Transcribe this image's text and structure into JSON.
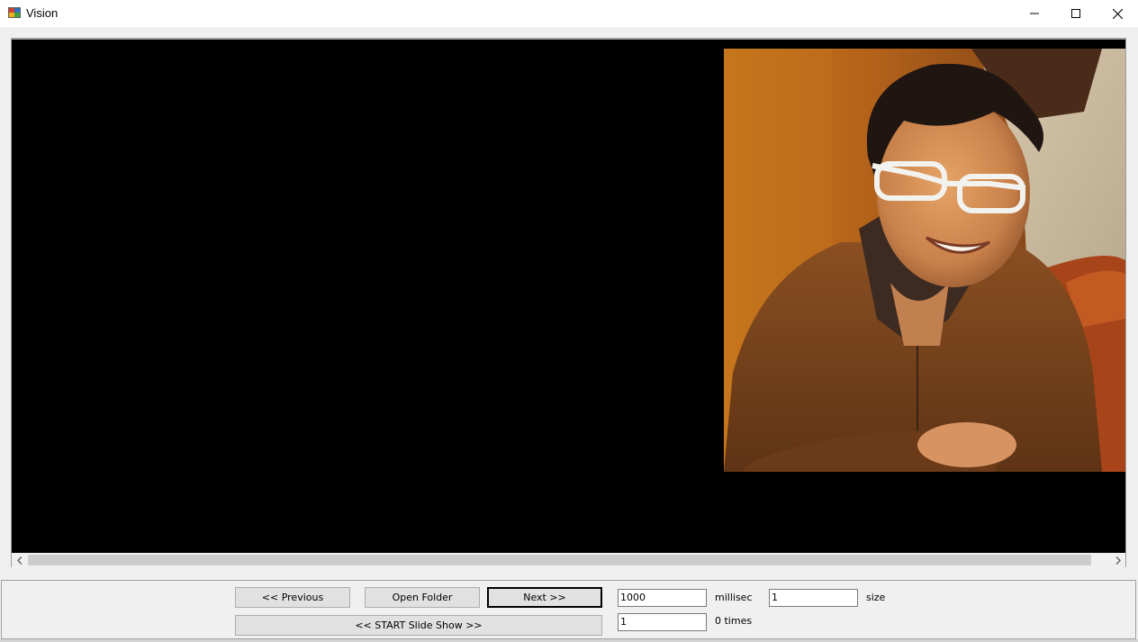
{
  "window": {
    "title": "Vision",
    "icon": "app-window-icon",
    "controls": [
      "minimize-icon",
      "maximize-icon",
      "close-icon"
    ]
  },
  "viewer": {
    "image_icon": "portrait-photo",
    "scrollbar": {
      "left_arrow": "chevron-left-icon",
      "right_arrow": "chevron-right-icon"
    }
  },
  "controls": {
    "previous_label": "<< Previous",
    "open_folder_label": "Open Folder",
    "next_label": "Next >>",
    "slideshow_label": "<< START Slide Show >>",
    "interval_value": "1000",
    "interval_unit": "millisec",
    "size_value": "1",
    "size_label": "size",
    "times_value": "1",
    "times_label": "0 times"
  }
}
